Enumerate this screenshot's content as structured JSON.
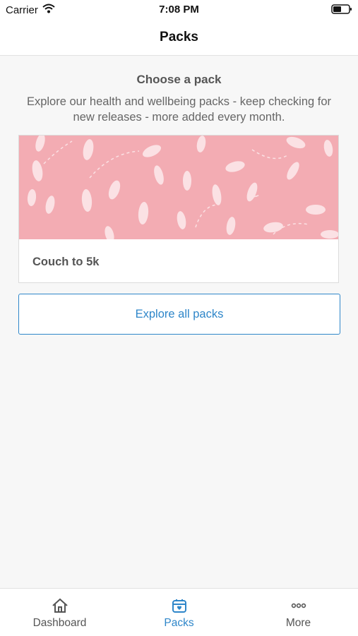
{
  "status_bar": {
    "carrier": "Carrier",
    "time": "7:08 PM"
  },
  "nav": {
    "title": "Packs"
  },
  "main": {
    "heading": "Choose a pack",
    "subtitle": "Explore our health and wellbeing packs - keep checking for new releases - more added every month.",
    "packs": [
      {
        "title": "Couch to 5k",
        "image_color": "#f3acb3"
      }
    ],
    "explore_button_label": "Explore all packs"
  },
  "tab_bar": {
    "items": [
      {
        "label": "Dashboard",
        "icon": "home-icon",
        "active": false
      },
      {
        "label": "Packs",
        "icon": "packs-icon",
        "active": true
      },
      {
        "label": "More",
        "icon": "more-icon",
        "active": false
      }
    ]
  },
  "colors": {
    "accent": "#2e86c9",
    "pack_image_bg": "#f3acb3",
    "footprint": "#fbe1e4"
  }
}
